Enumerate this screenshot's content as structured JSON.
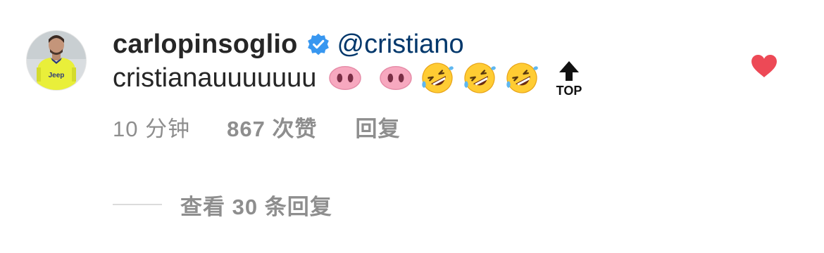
{
  "comment": {
    "username": "carlopinsoglio",
    "verified": true,
    "mention": "@cristiano",
    "text": "cristianauuuuuuu",
    "emojis": [
      "pig-nose",
      "pig-nose",
      "rolling-on-the-floor-laughing",
      "rolling-on-the-floor-laughing",
      "rolling-on-the-floor-laughing",
      "top-arrow"
    ],
    "top_label": "TOP",
    "avatar_jersey_text": "Jeep",
    "time": "10 分钟",
    "likes": "867 次赞",
    "reply_label": "回复",
    "liked": true,
    "view_replies": "查看 30 条回复"
  },
  "colors": {
    "username": "#262626",
    "mention": "#00376b",
    "meta": "#8e8e8e",
    "verified_badge": "#3897f0",
    "heart": "#ed4956",
    "pig": "#f7a8bf"
  }
}
